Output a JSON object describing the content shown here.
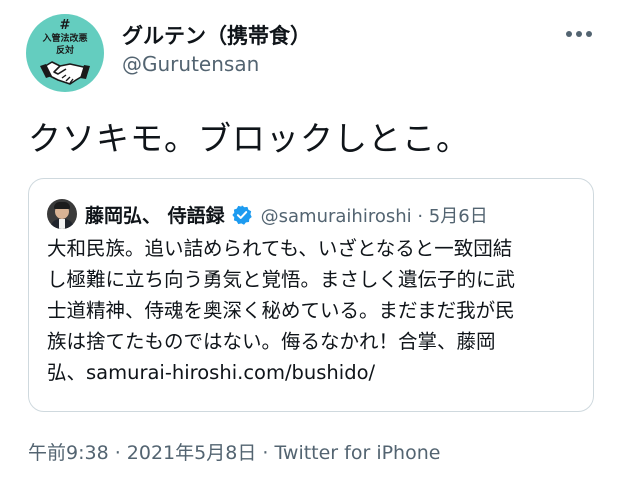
{
  "author": {
    "display_name": "グルテン（携帯食）",
    "handle": "@Gurutensan",
    "avatar": {
      "hash": "#",
      "line1": "入管法改悪",
      "line2": "反対",
      "icon": "handshake-icon",
      "bg_color": "#64cdbf"
    }
  },
  "tweet": {
    "text": "クソキモ。ブロックしとこ。"
  },
  "quoted": {
    "display_name": "藤岡弘、 侍語録",
    "verified_icon": "verified-badge-icon",
    "handle_and_date": "@samuraihiroshi · 5月6日",
    "lines": [
      "大和民族。追い詰められても、いざとなると一致団結",
      "し極難に立ち向う勇気と覚悟。まさしく遺伝子的に武",
      "士道精神、侍魂を奥深く秘めている。まだまだ我が民",
      "族は捨てたものではない。侮るなかれ！合掌、藤岡",
      "弘、samurai-hiroshi.com/bushido/"
    ]
  },
  "footer": {
    "timestamp": "午前9:38 · 2021年5月8日 · ",
    "client": "Twitter for iPhone"
  },
  "colors": {
    "text": "#0f1419",
    "muted": "#536471",
    "border": "#cfd9de",
    "verified": "#1d9bf0"
  }
}
